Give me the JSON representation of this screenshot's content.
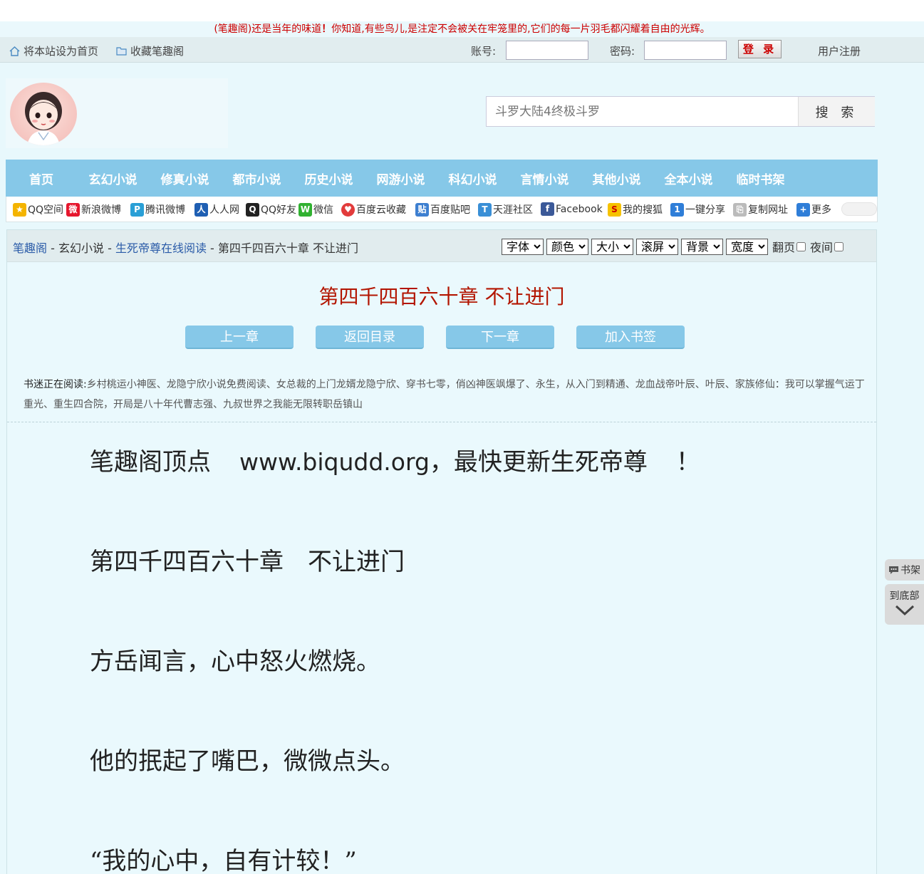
{
  "notice": {
    "prefix": "(笔趣阁)还是当年的味道",
    "bang": "！",
    "rest": "你知道,有些鸟儿,是注定不会被关在牢笼里的,它们的每一片羽毛都闪耀着自由的光辉。"
  },
  "userbar": {
    "set_home": "将本站设为首页",
    "bookmark_site": "收藏笔趣阁",
    "account_label": "账号:",
    "password_label": "密码:",
    "login": "登 录",
    "register": "用户注册"
  },
  "search": {
    "placeholder": "斗罗大陆4终极斗罗",
    "button": "搜 索"
  },
  "nav": [
    "首页",
    "玄幻小说",
    "修真小说",
    "都市小说",
    "历史小说",
    "网游小说",
    "科幻小说",
    "言情小说",
    "其他小说",
    "全本小说",
    "临时书架"
  ],
  "share": [
    {
      "label": "QQ空间",
      "icon": "qzone-icon",
      "color": "#f4b400"
    },
    {
      "label": "新浪微博",
      "icon": "weibo-icon",
      "color": "#e6162d"
    },
    {
      "label": "腾讯微博",
      "icon": "tencent-weibo-icon",
      "color": "#2a9fd6"
    },
    {
      "label": "人人网",
      "icon": "renren-icon",
      "color": "#1f5fb3"
    },
    {
      "label": "QQ好友",
      "icon": "qq-icon",
      "color": "#222222"
    },
    {
      "label": "微信",
      "icon": "wechat-icon",
      "color": "#31b131"
    },
    {
      "label": "百度云收藏",
      "icon": "heart-icon",
      "color": "#e23b3b"
    },
    {
      "label": "百度贴吧",
      "icon": "tieba-icon",
      "color": "#3d7fd0"
    },
    {
      "label": "天涯社区",
      "icon": "tianya-icon",
      "color": "#3a8fd6"
    },
    {
      "label": "Facebook",
      "icon": "facebook-icon",
      "color": "#3b5998"
    },
    {
      "label": "我的搜狐",
      "icon": "sohu-icon",
      "color": "#f6c200"
    },
    {
      "label": "一键分享",
      "icon": "one-key-share-icon",
      "color": "#2f7ed8"
    },
    {
      "label": "复制网址",
      "icon": "copy-url-icon",
      "color": "#bbbbbb"
    },
    {
      "label": "更多",
      "icon": "plus-icon",
      "color": "#2f7ed8"
    }
  ],
  "breadcrumb": {
    "site": "笔趣阁",
    "sep": " - ",
    "category": "玄幻小说",
    "book": "生死帝尊在线阅读",
    "chapter": "第四千四百六十章 不让进门"
  },
  "controls": {
    "font": "字体",
    "color": "颜色",
    "size": "大小",
    "scroll": "滚屏",
    "background": "背景",
    "width": "宽度",
    "page_turn": "翻页",
    "night": "夜间"
  },
  "chapter_title": "第四千四百六十章 不让进门",
  "buttons": {
    "prev": "上一章",
    "toc": "返回目录",
    "next": "下一章",
    "add_bookmark": "加入书签"
  },
  "reading": {
    "lead": "书迷正在阅读:",
    "list": "乡村桃运小神医、龙隐宁欣小说免费阅读、女总裁的上门龙婿龙隐宁欣、穿书七零，俏凶神医飒爆了、永生，从入门到精通、龙血战帝叶辰、叶辰、家族修仙：我可以掌握气运丁重光、重生四合院，开局是八十年代曹志强、九叔世界之我能无限转职岳镇山"
  },
  "paragraphs": [
    {
      "pre": "笔趣阁顶点",
      "url": "www.biqudd.org",
      "post": "，最快更新生死帝尊",
      "end": "！"
    },
    {
      "text": "第四千四百六十章　不让进门"
    },
    {
      "text": "方岳闻言，心中怒火燃烧。"
    },
    {
      "text": "他的抿起了嘴巴，微微点头。"
    },
    {
      "text": "“我的心中，自有计较！”"
    }
  ],
  "side": {
    "shelf": "书架",
    "to_bottom": "到底部"
  }
}
